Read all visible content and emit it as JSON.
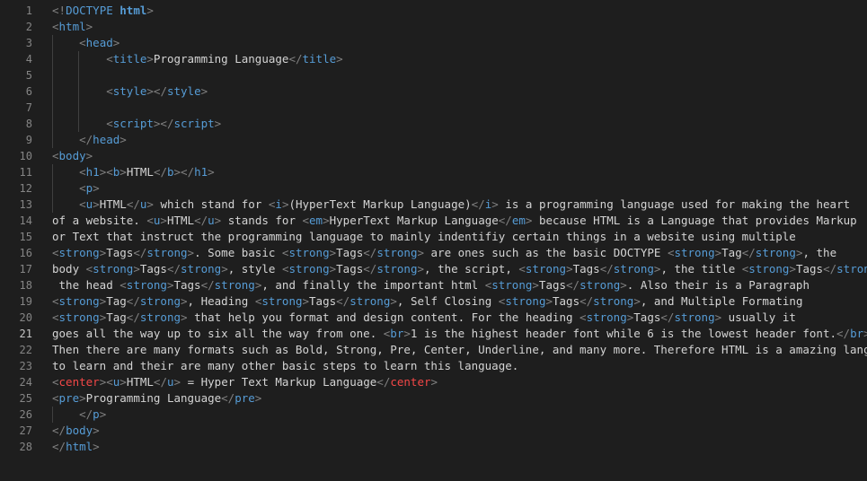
{
  "line_numbers": [
    "1",
    "2",
    "3",
    "4",
    "5",
    "6",
    "7",
    "8",
    "9",
    "10",
    "11",
    "12",
    "13",
    "14",
    "15",
    "16",
    "17",
    "18",
    "19",
    "20",
    "21",
    "22",
    "23",
    "24",
    "25",
    "26",
    "27",
    "28"
  ],
  "lines": [
    [
      [
        "p",
        "<!"
      ],
      [
        "t",
        "DOCTYPE "
      ],
      [
        "k",
        "html"
      ],
      [
        "p",
        ">"
      ]
    ],
    [
      [
        "p",
        "<"
      ],
      [
        "t",
        "html"
      ],
      [
        "p",
        ">"
      ]
    ],
    [
      [
        "x",
        "    "
      ],
      [
        "p",
        "<"
      ],
      [
        "t",
        "head"
      ],
      [
        "p",
        ">"
      ]
    ],
    [
      [
        "x",
        "        "
      ],
      [
        "p",
        "<"
      ],
      [
        "t",
        "title"
      ],
      [
        "p",
        ">"
      ],
      [
        "x",
        "Programming Language"
      ],
      [
        "p",
        "</"
      ],
      [
        "t",
        "title"
      ],
      [
        "p",
        ">"
      ]
    ],
    [],
    [
      [
        "x",
        "        "
      ],
      [
        "p",
        "<"
      ],
      [
        "t",
        "style"
      ],
      [
        "p",
        "></"
      ],
      [
        "t",
        "style"
      ],
      [
        "p",
        ">"
      ]
    ],
    [],
    [
      [
        "x",
        "        "
      ],
      [
        "p",
        "<"
      ],
      [
        "t",
        "script"
      ],
      [
        "p",
        "></"
      ],
      [
        "t",
        "script"
      ],
      [
        "p",
        ">"
      ]
    ],
    [
      [
        "x",
        "    "
      ],
      [
        "p",
        "</"
      ],
      [
        "t",
        "head"
      ],
      [
        "p",
        ">"
      ]
    ],
    [
      [
        "p",
        "<"
      ],
      [
        "t",
        "body"
      ],
      [
        "p",
        ">"
      ]
    ],
    [
      [
        "x",
        "    "
      ],
      [
        "p",
        "<"
      ],
      [
        "t",
        "h1"
      ],
      [
        "p",
        "><"
      ],
      [
        "t",
        "b"
      ],
      [
        "p",
        ">"
      ],
      [
        "x",
        "HTML"
      ],
      [
        "p",
        "</"
      ],
      [
        "t",
        "b"
      ],
      [
        "p",
        "></"
      ],
      [
        "t",
        "h1"
      ],
      [
        "p",
        ">"
      ]
    ],
    [
      [
        "x",
        "    "
      ],
      [
        "p",
        "<"
      ],
      [
        "t",
        "p"
      ],
      [
        "p",
        ">"
      ]
    ],
    [
      [
        "x",
        "    "
      ],
      [
        "p",
        "<"
      ],
      [
        "t",
        "u"
      ],
      [
        "p",
        ">"
      ],
      [
        "x",
        "HTML"
      ],
      [
        "p",
        "</"
      ],
      [
        "t",
        "u"
      ],
      [
        "p",
        ">"
      ],
      [
        "x",
        " which stand for "
      ],
      [
        "p",
        "<"
      ],
      [
        "t",
        "i"
      ],
      [
        "p",
        ">"
      ],
      [
        "x",
        "(HyperText Markup Language)"
      ],
      [
        "p",
        "</"
      ],
      [
        "t",
        "i"
      ],
      [
        "p",
        ">"
      ],
      [
        "x",
        " is a programming language used for making the heart"
      ]
    ],
    [
      [
        "x",
        "of a website. "
      ],
      [
        "p",
        "<"
      ],
      [
        "t",
        "u"
      ],
      [
        "p",
        ">"
      ],
      [
        "x",
        "HTML"
      ],
      [
        "p",
        "</"
      ],
      [
        "t",
        "u"
      ],
      [
        "p",
        ">"
      ],
      [
        "x",
        " stands for "
      ],
      [
        "p",
        "<"
      ],
      [
        "t",
        "em"
      ],
      [
        "p",
        ">"
      ],
      [
        "x",
        "HyperText Markup Language"
      ],
      [
        "p",
        "</"
      ],
      [
        "t",
        "em"
      ],
      [
        "p",
        ">"
      ],
      [
        "x",
        " because HTML is a Language that provides Markup"
      ]
    ],
    [
      [
        "x",
        "or Text that instruct the programming language to mainly indentifiy certain things in a website using multiple"
      ]
    ],
    [
      [
        "p",
        "<"
      ],
      [
        "t",
        "strong"
      ],
      [
        "p",
        ">"
      ],
      [
        "x",
        "Tags"
      ],
      [
        "p",
        "</"
      ],
      [
        "t",
        "strong"
      ],
      [
        "p",
        ">"
      ],
      [
        "x",
        ". Some basic "
      ],
      [
        "p",
        "<"
      ],
      [
        "t",
        "strong"
      ],
      [
        "p",
        ">"
      ],
      [
        "x",
        "Tags"
      ],
      [
        "p",
        "</"
      ],
      [
        "t",
        "strong"
      ],
      [
        "p",
        ">"
      ],
      [
        "x",
        " are ones such as the basic DOCTYPE "
      ],
      [
        "p",
        "<"
      ],
      [
        "t",
        "strong"
      ],
      [
        "p",
        ">"
      ],
      [
        "x",
        "Tag"
      ],
      [
        "p",
        "</"
      ],
      [
        "t",
        "strong"
      ],
      [
        "p",
        ">"
      ],
      [
        "x",
        ", the"
      ]
    ],
    [
      [
        "x",
        "body "
      ],
      [
        "p",
        "<"
      ],
      [
        "t",
        "strong"
      ],
      [
        "p",
        ">"
      ],
      [
        "x",
        "Tags"
      ],
      [
        "p",
        "</"
      ],
      [
        "t",
        "strong"
      ],
      [
        "p",
        ">"
      ],
      [
        "x",
        ", style "
      ],
      [
        "p",
        "<"
      ],
      [
        "t",
        "strong"
      ],
      [
        "p",
        ">"
      ],
      [
        "x",
        "Tags"
      ],
      [
        "p",
        "</"
      ],
      [
        "t",
        "strong"
      ],
      [
        "p",
        ">"
      ],
      [
        "x",
        ", the script, "
      ],
      [
        "p",
        "<"
      ],
      [
        "t",
        "strong"
      ],
      [
        "p",
        ">"
      ],
      [
        "x",
        "Tags"
      ],
      [
        "p",
        "</"
      ],
      [
        "t",
        "strong"
      ],
      [
        "p",
        ">"
      ],
      [
        "x",
        ", the title "
      ],
      [
        "p",
        "<"
      ],
      [
        "t",
        "strong"
      ],
      [
        "p",
        ">"
      ],
      [
        "x",
        "Tags"
      ],
      [
        "p",
        "</"
      ],
      [
        "t",
        "strong"
      ],
      [
        "p",
        ">"
      ],
      [
        "x",
        ","
      ]
    ],
    [
      [
        "x",
        " the head "
      ],
      [
        "p",
        "<"
      ],
      [
        "t",
        "strong"
      ],
      [
        "p",
        ">"
      ],
      [
        "x",
        "Tags"
      ],
      [
        "p",
        "</"
      ],
      [
        "t",
        "strong"
      ],
      [
        "p",
        ">"
      ],
      [
        "x",
        ", and finally the important html "
      ],
      [
        "p",
        "<"
      ],
      [
        "t",
        "strong"
      ],
      [
        "p",
        ">"
      ],
      [
        "x",
        "Tags"
      ],
      [
        "p",
        "</"
      ],
      [
        "t",
        "strong"
      ],
      [
        "p",
        ">"
      ],
      [
        "x",
        ". Also their is a Paragraph"
      ]
    ],
    [
      [
        "p",
        "<"
      ],
      [
        "t",
        "strong"
      ],
      [
        "p",
        ">"
      ],
      [
        "x",
        "Tag"
      ],
      [
        "p",
        "</"
      ],
      [
        "t",
        "strong"
      ],
      [
        "p",
        ">"
      ],
      [
        "x",
        ", Heading "
      ],
      [
        "p",
        "<"
      ],
      [
        "t",
        "strong"
      ],
      [
        "p",
        ">"
      ],
      [
        "x",
        "Tags"
      ],
      [
        "p",
        "</"
      ],
      [
        "t",
        "strong"
      ],
      [
        "p",
        ">"
      ],
      [
        "x",
        ", Self Closing "
      ],
      [
        "p",
        "<"
      ],
      [
        "t",
        "strong"
      ],
      [
        "p",
        ">"
      ],
      [
        "x",
        "Tags"
      ],
      [
        "p",
        "</"
      ],
      [
        "t",
        "strong"
      ],
      [
        "p",
        ">"
      ],
      [
        "x",
        ", and Multiple Formating"
      ]
    ],
    [
      [
        "p",
        "<"
      ],
      [
        "t",
        "strong"
      ],
      [
        "p",
        ">"
      ],
      [
        "x",
        "Tag"
      ],
      [
        "p",
        "</"
      ],
      [
        "t",
        "strong"
      ],
      [
        "p",
        ">"
      ],
      [
        "x",
        " that help you format and design content. For the heading "
      ],
      [
        "p",
        "<"
      ],
      [
        "t",
        "strong"
      ],
      [
        "p",
        ">"
      ],
      [
        "x",
        "Tags"
      ],
      [
        "p",
        "</"
      ],
      [
        "t",
        "strong"
      ],
      [
        "p",
        ">"
      ],
      [
        "x",
        " usually it"
      ]
    ],
    [
      [
        "x",
        "goes all the way up to six all the way from one. "
      ],
      [
        "p",
        "<"
      ],
      [
        "t",
        "br"
      ],
      [
        "p",
        ">"
      ],
      [
        "x",
        "1 is the highest header font while 6 is the lowest header font."
      ],
      [
        "p",
        "</"
      ],
      [
        "t",
        "br"
      ],
      [
        "p",
        ">"
      ]
    ],
    [
      [
        "x",
        "Then there are many formats such as Bold, Strong, Pre, Center, Underline, and many more. Therefore HTML is a amazing langage"
      ]
    ],
    [
      [
        "x",
        "to learn and their are many other basic steps to learn this language."
      ]
    ],
    [
      [
        "p",
        "<"
      ],
      [
        "r",
        "center"
      ],
      [
        "p",
        "><"
      ],
      [
        "t",
        "u"
      ],
      [
        "p",
        ">"
      ],
      [
        "x",
        "HTML"
      ],
      [
        "p",
        "</"
      ],
      [
        "t",
        "u"
      ],
      [
        "p",
        ">"
      ],
      [
        "x",
        " = Hyper Text Markup Language"
      ],
      [
        "p",
        "</"
      ],
      [
        "r",
        "center"
      ],
      [
        "p",
        ">"
      ]
    ],
    [
      [
        "p",
        "<"
      ],
      [
        "t",
        "pre"
      ],
      [
        "p",
        ">"
      ],
      [
        "x",
        "Programming Language"
      ],
      [
        "p",
        "</"
      ],
      [
        "t",
        "pre"
      ],
      [
        "p",
        ">"
      ]
    ],
    [
      [
        "x",
        "    "
      ],
      [
        "p",
        "</"
      ],
      [
        "t",
        "p"
      ],
      [
        "p",
        ">"
      ]
    ],
    [
      [
        "p",
        "</"
      ],
      [
        "t",
        "body"
      ],
      [
        "p",
        ">"
      ]
    ],
    [
      [
        "p",
        "</"
      ],
      [
        "t",
        "html"
      ],
      [
        "p",
        ">"
      ]
    ]
  ],
  "current_line": 21,
  "colors": {
    "background": "#1e1e1e",
    "tag": "#569cd6",
    "punctuation": "#808080",
    "text": "#d4d4d4",
    "deprecated_tag": "#f44747",
    "line_number": "#858585"
  }
}
